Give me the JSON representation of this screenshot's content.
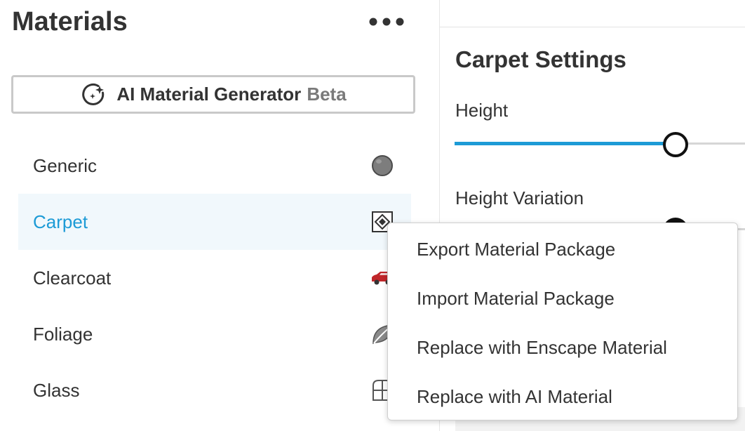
{
  "left_panel": {
    "title": "Materials",
    "more_icon": "ellipsis-icon",
    "ai_generator": {
      "label": "AI Material Generator",
      "badge": "Beta",
      "icon": "ai-sparkle-icon"
    },
    "materials": [
      {
        "label": "Generic",
        "icon": "sphere-icon",
        "selected": false
      },
      {
        "label": "Carpet",
        "icon": "carpet-icon",
        "selected": true
      },
      {
        "label": "Clearcoat",
        "icon": "car-icon",
        "selected": false
      },
      {
        "label": "Foliage",
        "icon": "leaf-icon",
        "selected": false
      },
      {
        "label": "Glass",
        "icon": "window-icon",
        "selected": false
      }
    ]
  },
  "right_panel": {
    "title": "Carpet Settings",
    "settings": [
      {
        "label": "Height",
        "value": 0.76
      },
      {
        "label": "Height Variation",
        "value": 0.76
      }
    ]
  },
  "context_menu": {
    "items": [
      "Export Material Package",
      "Import Material Package",
      "Replace with Enscape Material",
      "Replace with AI Material"
    ]
  },
  "colors": {
    "accent": "#1d9bd6",
    "selected_bg": "#f1f8fc",
    "text": "#333333",
    "muted": "#7a7a7a"
  }
}
